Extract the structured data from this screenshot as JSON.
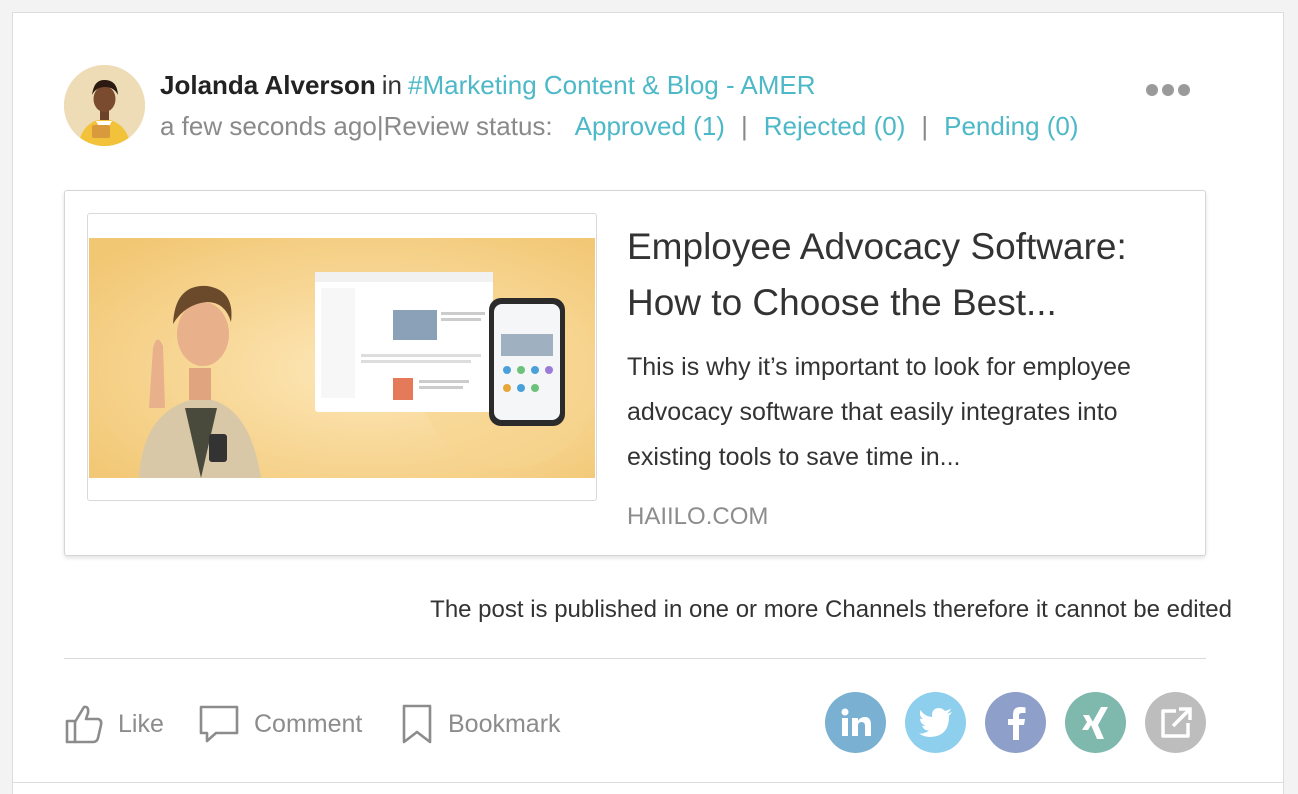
{
  "post": {
    "author": "Jolanda Alverson",
    "in_word": "in",
    "channel": "#Marketing Content & Blog - AMER",
    "time": "a few seconds ago",
    "separator": "|",
    "review_label": "Review status:",
    "approved": "Approved (1)",
    "rejected": "Rejected (0)",
    "pending": "Pending (0)",
    "status_sep": "|",
    "more_icon": "more-horizontal-icon"
  },
  "link_card": {
    "title": "Employee Advocacy Software: How to Choose the Best...",
    "description": "This is why it’s important to look for employee advocacy software that easily integrates into existing tools to save time in...",
    "domain": "HAIILO.COM"
  },
  "notice": "The post is published in one or more Channels therefore it cannot be edited",
  "actions": {
    "like": "Like",
    "comment": "Comment",
    "bookmark": "Bookmark"
  },
  "share_icons": [
    "linkedin-icon",
    "twitter-icon",
    "facebook-icon",
    "xing-icon",
    "external-share-icon"
  ],
  "colors": {
    "accent": "#4db8c7",
    "linkedin": "#7ab0d1",
    "twitter": "#8ecfee",
    "facebook": "#8e9fc9",
    "xing": "#7fb8ac",
    "external": "#bdbdbd"
  }
}
